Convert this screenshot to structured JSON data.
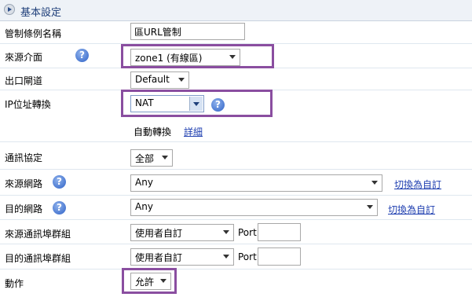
{
  "header": {
    "title": "基本設定"
  },
  "fields": {
    "policy_name": {
      "label": "管制條例名稱",
      "value": "區URL管制"
    },
    "source_interface": {
      "label": "來源介面",
      "value": "zone1 (有線區)"
    },
    "exit_gateway": {
      "label": "出口閘道",
      "value": "Default"
    },
    "ip_translation": {
      "label": "IP位址轉換",
      "value": "NAT",
      "auto_text": "自動轉換",
      "detail_link": "詳細"
    },
    "protocol": {
      "label": "通訊協定",
      "value": "全部"
    },
    "source_network": {
      "label": "來源網路",
      "value": "Any",
      "switch_link": "切換為自訂"
    },
    "dest_network": {
      "label": "目的網路",
      "value": "Any",
      "switch_link": "切換為自訂"
    },
    "source_port_group": {
      "label": "來源通訊埠群組",
      "value": "使用者自訂",
      "port_label": "Port",
      "port_value": ""
    },
    "dest_port_group": {
      "label": "目的通訊埠群組",
      "value": "使用者自訂",
      "port_label": "Port",
      "port_value": ""
    },
    "action": {
      "label": "動作",
      "value": "允許"
    }
  },
  "icons": {
    "help": "?"
  },
  "colors": {
    "highlight": "#8a4ea0",
    "link": "#1f3fb0",
    "header_text": "#1f3f7a"
  }
}
